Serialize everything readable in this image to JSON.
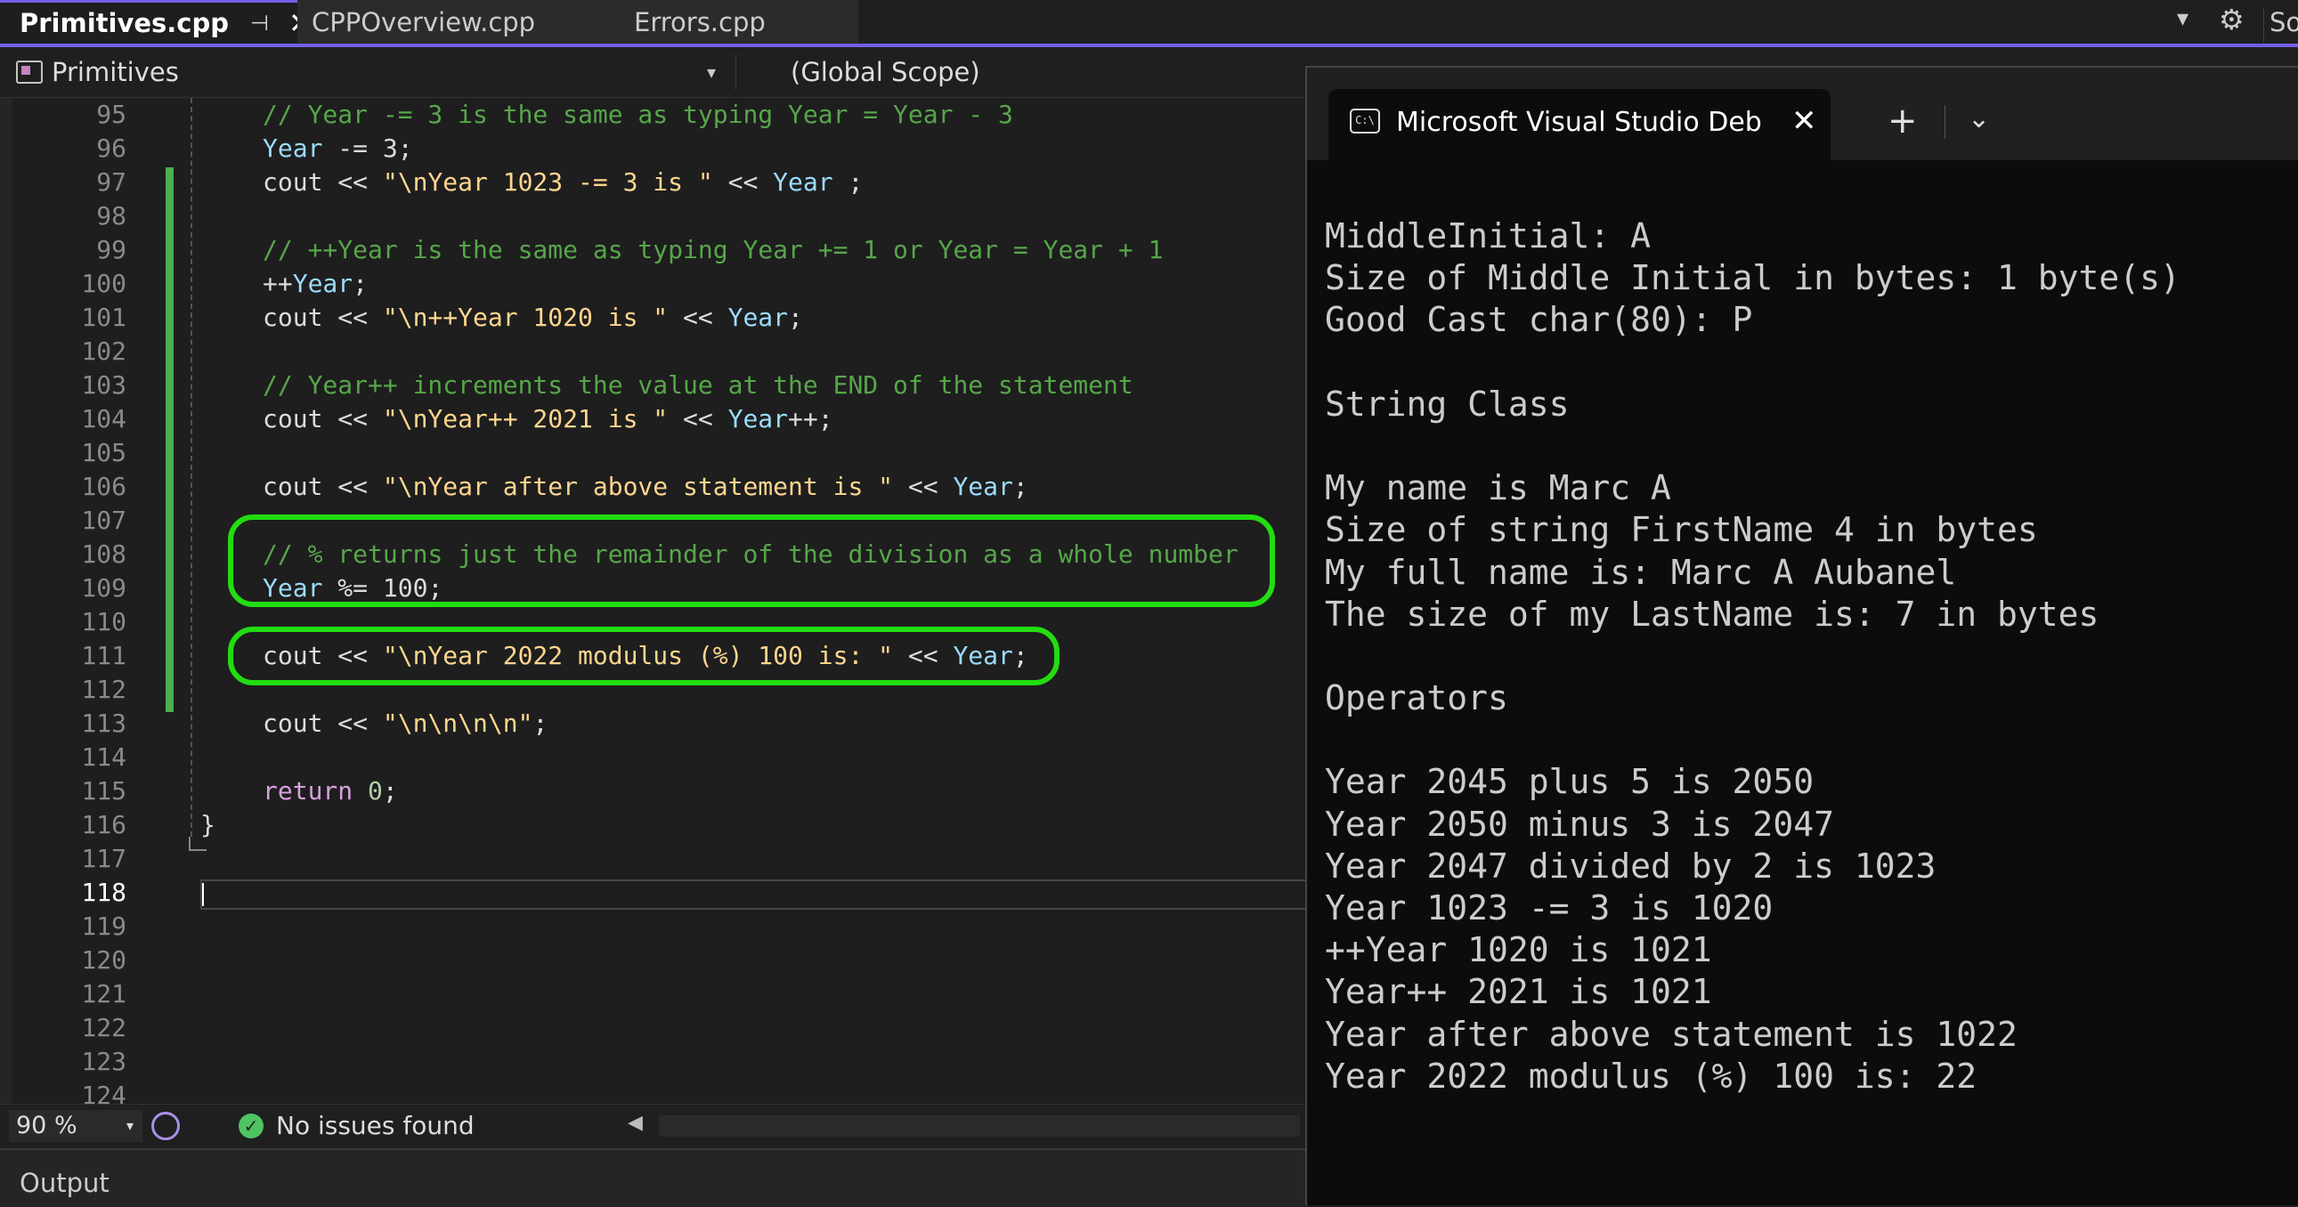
{
  "tabs": [
    {
      "label": "Primitives.cpp",
      "active": true
    },
    {
      "label": "CPPOverview.cpp",
      "active": false
    },
    {
      "label": "Errors.cpp",
      "active": false
    }
  ],
  "tabstrip": {
    "pin_glyph": "⊣",
    "close_glyph": "✕",
    "dropdown_glyph": "▾",
    "gear_glyph": "⚙",
    "solution_explorer_label": "So"
  },
  "navbar": {
    "member_label": "Primitives",
    "scope_label": "(Global Scope)",
    "chevron": "▾"
  },
  "editor": {
    "line_numbers": [
      "95",
      "96",
      "97",
      "98",
      "99",
      "100",
      "101",
      "102",
      "103",
      "104",
      "105",
      "106",
      "107",
      "108",
      "109",
      "110",
      "111",
      "112",
      "113",
      "114",
      "115",
      "116",
      "117",
      "118",
      "119",
      "120",
      "121",
      "122",
      "123",
      "124"
    ],
    "current_line": "118",
    "code": {
      "l95": "// Year -= 3 is the same as typing Year = Year - 3",
      "l96_var": "Year",
      "l96_rest": " -= 3;",
      "l97_pre": "cout << ",
      "l97_str": "\"\\nYear 1023 -= 3 is \"",
      "l97_mid": " << ",
      "l97_var": "Year",
      "l97_end": " ;",
      "l99": "// ++Year is the same as typing Year += 1 or Year = Year + 1",
      "l100_pre": "++",
      "l100_var": "Year",
      "l100_end": ";",
      "l101_pre": "cout << ",
      "l101_str": "\"\\n++Year 1020 is \"",
      "l101_mid": " << ",
      "l101_var": "Year",
      "l101_end": ";",
      "l103": "// Year++ increments the value at the END of the statement",
      "l104_pre": "cout << ",
      "l104_str": "\"\\nYear++ 2021 is \"",
      "l104_mid": " << ",
      "l104_var": "Year",
      "l104_end": "++;",
      "l106_pre": "cout << ",
      "l106_str": "\"\\nYear after above statement is \"",
      "l106_mid": " << ",
      "l106_var": "Year",
      "l106_end": ";",
      "l108": "// % returns just the remainder of the division as a whole number",
      "l109_var": "Year",
      "l109_rest": " %= 100;",
      "l111_pre": "cout << ",
      "l111_str": "\"\\nYear 2022 modulus (%) 100 is: \"",
      "l111_mid": " << ",
      "l111_var": "Year",
      "l111_end": ";",
      "l113_pre": "cout << ",
      "l113_str": "\"\\n\\n\\n\\n\"",
      "l113_end": ";",
      "l115_kw": "return",
      "l115_num": " 0",
      "l115_end": ";",
      "l116": "}"
    }
  },
  "statusbar": {
    "zoom": "90 %",
    "zoom_chevron": "▾",
    "issues": "No issues found",
    "issues_glyph": "✓",
    "scroll_left_glyph": "◀"
  },
  "output_panel": {
    "title": "Output"
  },
  "terminal": {
    "tab_title": "Microsoft Visual Studio Debug Console",
    "icon_text": "C:\\",
    "close_glyph": "✕",
    "new_tab_glyph": "+",
    "dropdown_glyph": "⌄",
    "lines": [
      "MiddleInitial: A",
      "Size of Middle Initial in bytes: 1 byte(s)",
      "Good Cast char(80): P",
      "",
      "String Class",
      "",
      "My name is Marc A",
      "Size of string FirstName 4 in bytes",
      "My full name is: Marc A Aubanel",
      "The size of my LastName is: 7 in bytes",
      "",
      "Operators",
      "",
      "Year 2045 plus 5 is 2050",
      "Year 2050 minus 3 is 2047",
      "Year 2047 divided by 2 is 1023",
      "Year 1023 -= 3 is 1020",
      "++Year 1020 is 1021",
      "Year++ 2021 is 1021",
      "Year after above statement is 1022",
      "Year 2022 modulus (%) 100 is: 22"
    ]
  },
  "colors": {
    "accent": "#7160e8",
    "highlight_box": "#22dd11",
    "change_bar": "#4caf50",
    "comment": "#57a64a",
    "string": "#ffd68f",
    "variable": "#9cdcfe",
    "keyword": "#d8a0df"
  }
}
